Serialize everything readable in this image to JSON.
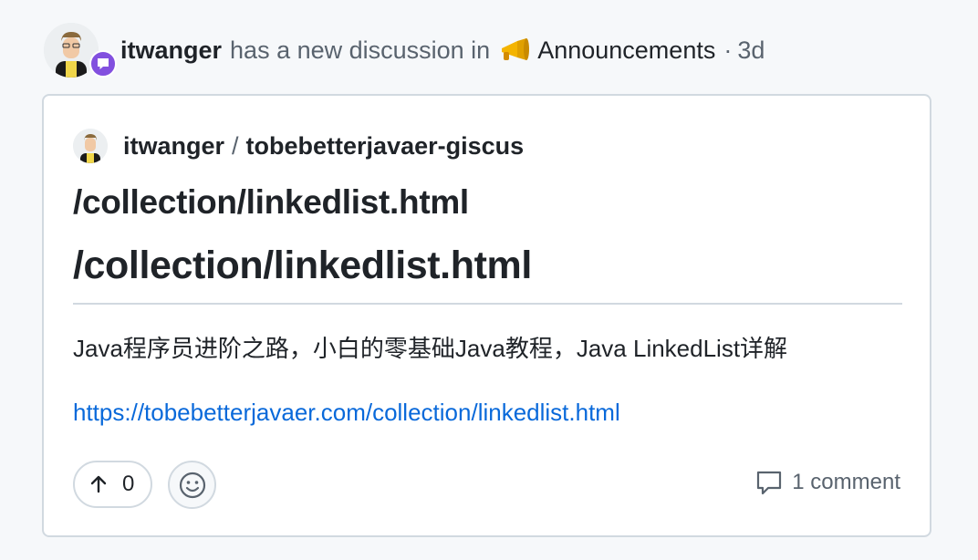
{
  "header": {
    "actor": "itwanger",
    "action": "has a new discussion in",
    "channel_icon": "megaphone-icon",
    "channel": "Announcements",
    "separator": "·",
    "age": "3d"
  },
  "card": {
    "repo_owner": "itwanger",
    "repo_separator": "/",
    "repo_name": "tobebetterjavaer-giscus",
    "title": "/collection/linkedlist.html",
    "body_heading": "/collection/linkedlist.html",
    "body_text": "Java程序员进阶之路，小白的零基础Java教程，Java LinkedList详解",
    "body_link": "https://tobebetterjavaer.com/collection/linkedlist.html",
    "upvote_count": "0",
    "comments_label": "1 comment"
  },
  "colors": {
    "accent_purple": "#8250df",
    "link_blue": "#0969da",
    "text": "#1f2328",
    "muted": "#59636e",
    "border": "#d1d9e0"
  }
}
